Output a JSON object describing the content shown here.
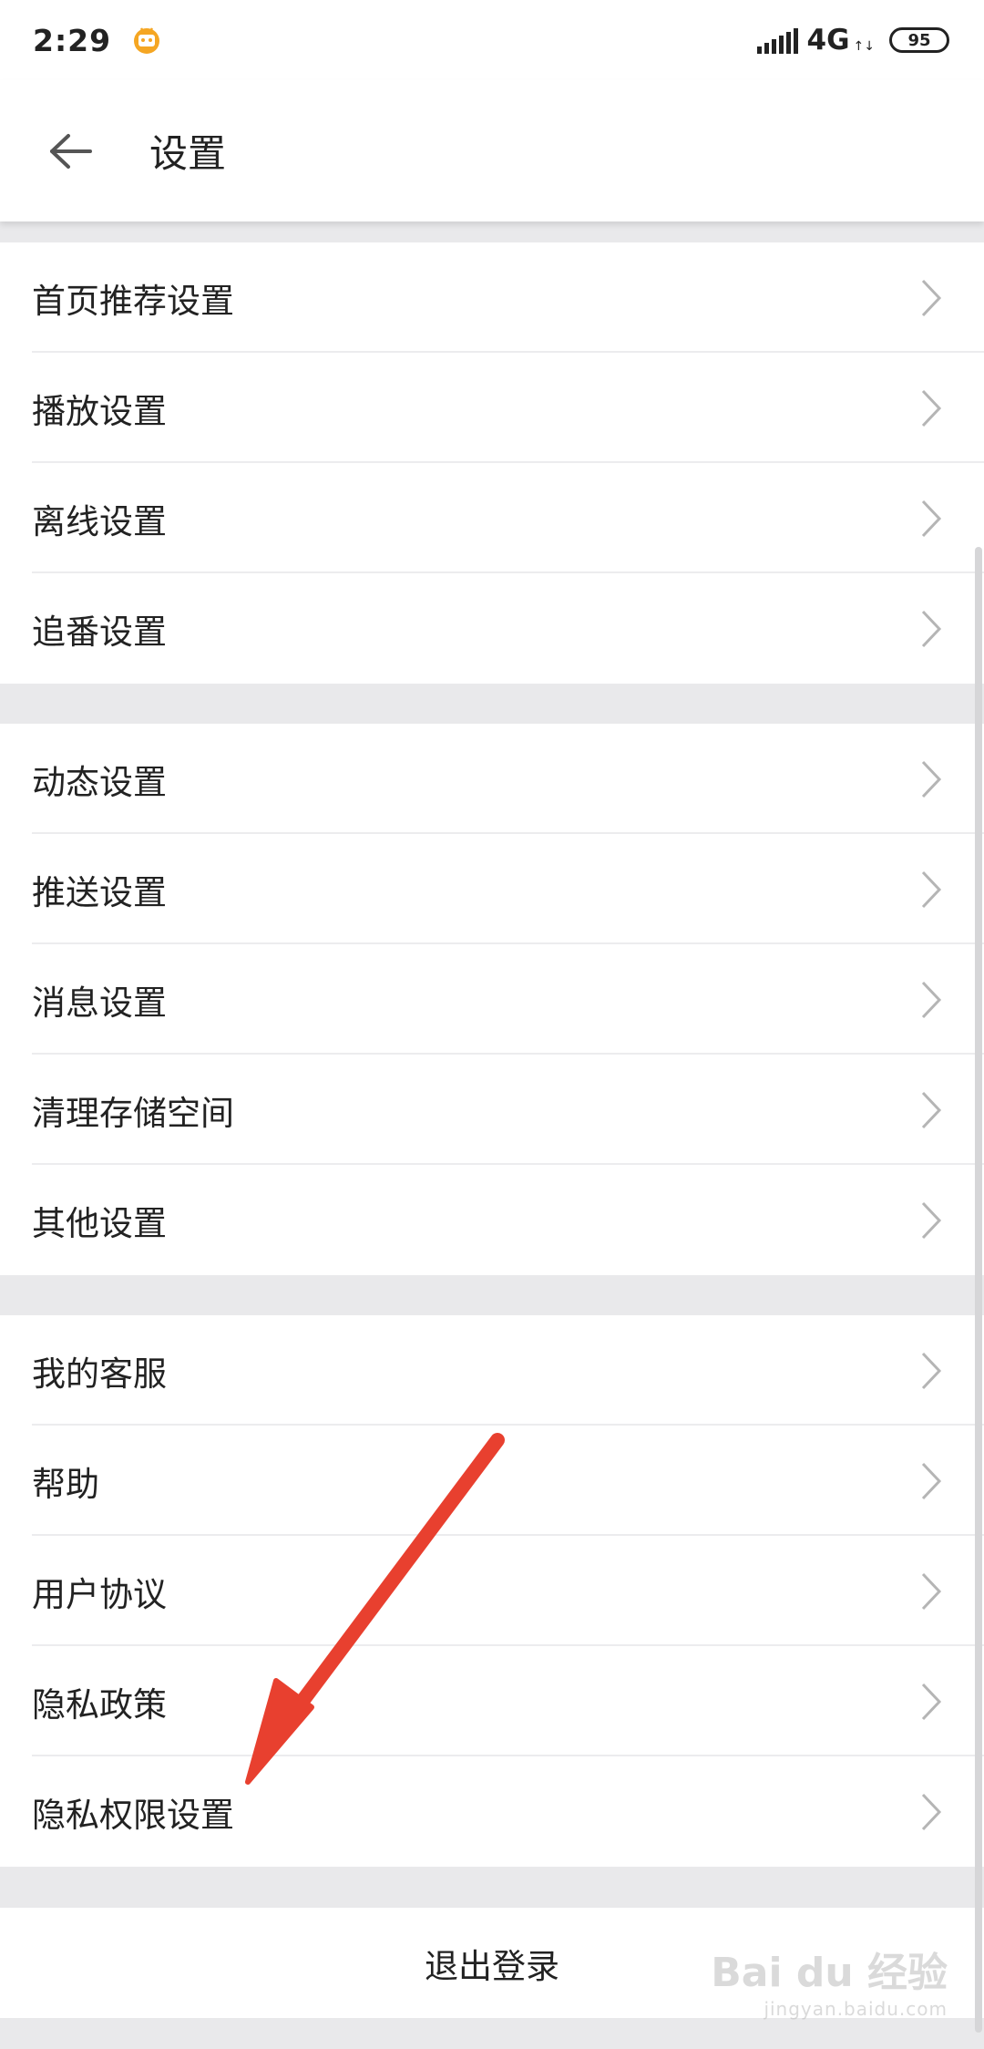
{
  "status_bar": {
    "time": "2:29",
    "network": "4G",
    "network_arrows": "↑↓",
    "battery": "95",
    "app_badge_icon": "bilibili-tv-icon"
  },
  "header": {
    "title": "设置",
    "back_icon": "arrow-left-icon"
  },
  "groups": [
    {
      "items": [
        "首页推荐设置",
        "播放设置",
        "离线设置",
        "追番设置"
      ]
    },
    {
      "items": [
        "动态设置",
        "推送设置",
        "消息设置",
        "清理存储空间",
        "其他设置"
      ]
    },
    {
      "items": [
        "我的客服",
        "帮助",
        "用户协议",
        "隐私政策",
        "隐私权限设置"
      ]
    }
  ],
  "logout": {
    "label": "退出登录"
  },
  "watermark": {
    "logo": "Bai du 经验",
    "sub": "jingyan.baidu.com"
  },
  "annotation": {
    "color": "#e8402f",
    "points_to": "隐私权限设置"
  },
  "colors": {
    "background": "#e9e9eb",
    "row": "#ffffff",
    "text": "#222222",
    "chevron": "#b5b5b5"
  }
}
